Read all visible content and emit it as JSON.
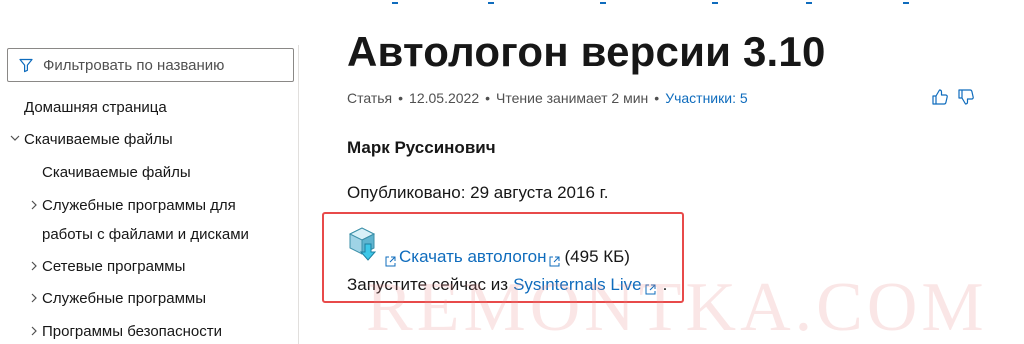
{
  "sidebar": {
    "filter_placeholder": "Фильтровать по названию",
    "items": [
      {
        "label": "Домашняя страница"
      },
      {
        "label": "Скачиваемые файлы"
      },
      {
        "label": "Скачиваемые файлы"
      },
      {
        "label": "Служебные программы для"
      },
      {
        "label": "работы с файлами и дисками"
      },
      {
        "label": "Сетевые программы"
      },
      {
        "label": "Служебные программы"
      },
      {
        "label": "Программы безопасности"
      }
    ]
  },
  "article": {
    "title": "Автологон версии 3.10",
    "meta": {
      "type": "Статья",
      "date": "12.05.2022",
      "read_time": "Чтение занимает 2 мин",
      "contributors": "Участники: 5"
    },
    "author": "Марк Руссинович",
    "published": "Опубликовано: 29 августа 2016 г.",
    "download_link": "Скачать автологон",
    "download_size": "(495 КБ)",
    "run_prefix": "Запустите сейчас из",
    "run_link": "Sysinternals Live",
    "run_suffix": "."
  },
  "watermark": "REMONTKA.COM",
  "colors": {
    "accent": "#0f6cbd",
    "highlight": "#e84a4a",
    "text": "#171717",
    "muted": "#505050"
  }
}
